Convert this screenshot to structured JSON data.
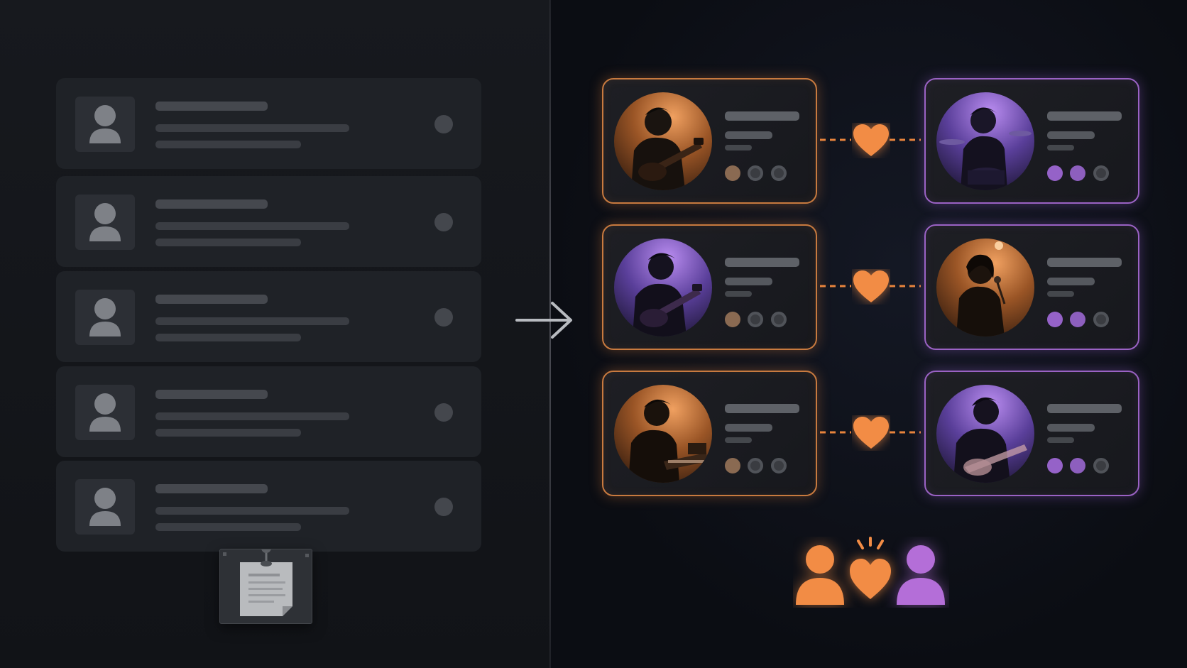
{
  "left_list": {
    "rows": [
      {
        "id": 1
      },
      {
        "id": 2
      },
      {
        "id": 3
      },
      {
        "id": 4
      },
      {
        "id": 5
      }
    ]
  },
  "icons": {
    "transition_arrow": "right-arrow-icon",
    "match_connector": "heart-icon",
    "footer": [
      "person-icon",
      "heart-icon",
      "person-icon"
    ],
    "list_note": "pinned-note-icon"
  },
  "colors": {
    "orange_accent": "#f28c45",
    "purple_accent": "#b46ed8",
    "left_row_background": "#1f2227",
    "right_background": "#0b0d13"
  },
  "matches": [
    {
      "left_profile": {
        "scene": "guitarist",
        "tone": "warm-orange"
      },
      "right_profile": {
        "scene": "drummer",
        "tone": "purple"
      }
    },
    {
      "left_profile": {
        "scene": "guitarist",
        "tone": "purple"
      },
      "right_profile": {
        "scene": "singer",
        "tone": "warm-orange"
      }
    },
    {
      "left_profile": {
        "scene": "keyboardist",
        "tone": "warm-orange"
      },
      "right_profile": {
        "scene": "guitarist",
        "tone": "purple"
      }
    }
  ]
}
